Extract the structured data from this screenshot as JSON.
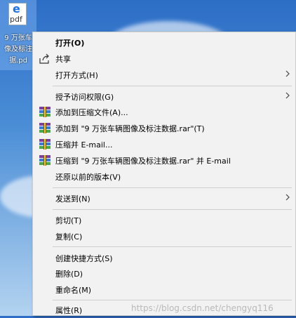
{
  "desktop": {
    "file_icon_text": "pdf",
    "file_label": "9 万张车\n像及标注\n据.pd"
  },
  "menu": {
    "items": [
      {
        "label": "打开(O)",
        "icon": "none",
        "submenu": false,
        "bold": true
      },
      {
        "label": "共享",
        "icon": "share-icon",
        "submenu": false
      },
      {
        "label": "打开方式(H)",
        "icon": "none",
        "submenu": true
      },
      {
        "label": "授予访问权限(G)",
        "icon": "none",
        "submenu": true
      },
      {
        "label": "添加到压缩文件(A)...",
        "icon": "winrar-icon",
        "submenu": false
      },
      {
        "label": "添加到 \"9 万张车辆图像及标注数据.rar\"(T)",
        "icon": "winrar-icon",
        "submenu": false
      },
      {
        "label": "压缩并 E-mail...",
        "icon": "winrar-icon",
        "submenu": false
      },
      {
        "label": "压缩到 \"9 万张车辆图像及标注数据.rar\" 并 E-mail",
        "icon": "winrar-icon",
        "submenu": false
      },
      {
        "label": "还原以前的版本(V)",
        "icon": "none",
        "submenu": false
      },
      {
        "label": "发送到(N)",
        "icon": "none",
        "submenu": true
      },
      {
        "label": "剪切(T)",
        "icon": "none",
        "submenu": false
      },
      {
        "label": "复制(C)",
        "icon": "none",
        "submenu": false
      },
      {
        "label": "创建快捷方式(S)",
        "icon": "none",
        "submenu": false
      },
      {
        "label": "删除(D)",
        "icon": "none",
        "submenu": false
      },
      {
        "label": "重命名(M)",
        "icon": "none",
        "submenu": false
      },
      {
        "label": "属性(R)",
        "icon": "none",
        "submenu": false
      }
    ]
  },
  "watermark": "https://blog.csdn.net/chengyq116",
  "colors": {
    "menu_bg": "#f2f2f2",
    "separator": "#cfcfcf",
    "desktop_top": "#2d6ec6"
  }
}
